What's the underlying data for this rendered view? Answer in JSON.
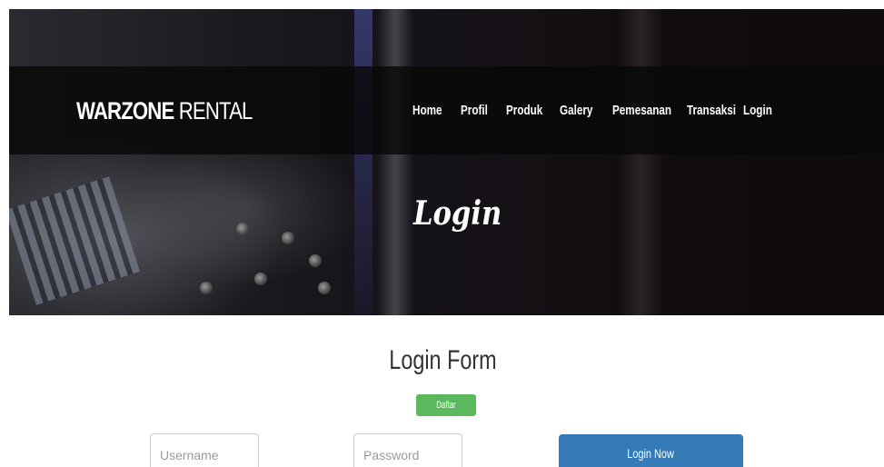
{
  "brand": {
    "bold": "WARZONE",
    "light": " RENTAL"
  },
  "nav": {
    "home": "Home",
    "profil": "Profil",
    "produk": "Produk",
    "galery": "Galery",
    "pemesanan": "Pemesanan",
    "transaksi": "Transaksi",
    "login": "Login"
  },
  "hero": {
    "title": "Login"
  },
  "form": {
    "title": "Login Form",
    "register_label": "Daftar Sekarang",
    "username_placeholder": "Username",
    "password_placeholder": "Password",
    "submit_label": "Login Now"
  },
  "colors": {
    "register_button": "#5cb85c",
    "login_button": "#337ab7",
    "navbar": "#080808"
  }
}
